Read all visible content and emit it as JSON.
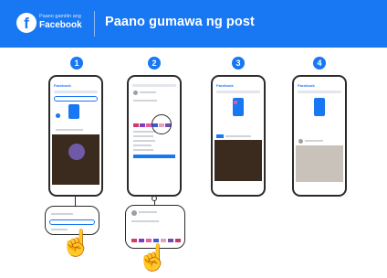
{
  "header": {
    "brand_small": "Paano gamitin ang",
    "brand_name": "Facebook",
    "title": "Paano gumawa ng post"
  },
  "steps": [
    "1",
    "2",
    "3",
    "4"
  ],
  "colors": {
    "facebook_blue": "#1877f2",
    "outline": "#2b2b2b"
  }
}
